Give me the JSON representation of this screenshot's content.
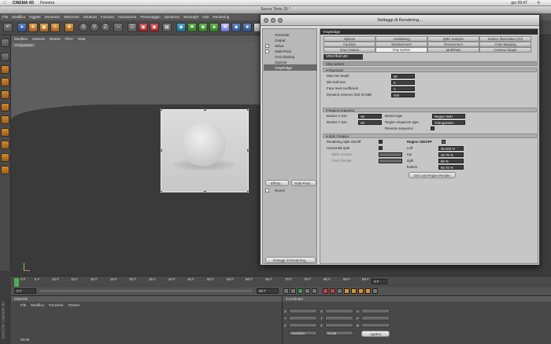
{
  "mac_menubar": {
    "app_name": "CINEMA 4D",
    "menu": "Finestra",
    "clock": "gio 09:47"
  },
  "app": {
    "title": "Senza Titolo 20 *",
    "menu": [
      "File",
      "Modifica",
      "Oggetti",
      "Strumenti",
      "Selezione",
      "Struttura",
      "Funzioni",
      "Animazione",
      "Personaggio",
      "Dynamics",
      "MoGraph",
      "Hair",
      "Rendering"
    ]
  },
  "viewport": {
    "menu": [
      "Modifica",
      "Camera",
      "Mostra",
      "Filtro",
      "Vista"
    ],
    "label": "Prospettiva"
  },
  "dialog": {
    "title": "Settaggi di Rendering...",
    "nav": [
      {
        "label": "Generale",
        "checkbox": false
      },
      {
        "label": "Output",
        "checkbox": false
      },
      {
        "label": "Salva",
        "checkbox": true
      },
      {
        "label": "Multi-Pass",
        "checkbox": true
      },
      {
        "label": "Anti-Aliasing",
        "checkbox": false
      },
      {
        "label": "Opzioni",
        "checkbox": false
      },
      {
        "label": "VrayBridge",
        "checkbox": false,
        "selected": true
      }
    ],
    "effects_button": "Effetto...",
    "multipass_button": "Multi-Pass...",
    "new_item": "Nuovo",
    "footer_button": "Settaggi di Rendering...",
    "panel_header": "VrayBridge",
    "tabs_row1": [
      "Options",
      "Antialiasing",
      "QMC Sampler",
      "Indirect Illumination (GI)"
    ],
    "tabs_row2": [
      "Caustics",
      "Displacement",
      "Environment",
      "Color Mapping"
    ],
    "tabs_row3": [
      "Vray Camera",
      "Vray system",
      "MultiPass",
      "Camera Clipper"
    ],
    "active_tab": "Vray system",
    "logo": "VRAYforC4D",
    "section_title": "Vray system",
    "raycaster": {
      "heading": "Raycaster",
      "fields": [
        {
          "label": "Max tree depth",
          "value": "60"
        },
        {
          "label": "Min leaf size",
          "value": "0"
        },
        {
          "label": "Face level coefficient",
          "value": "1"
        },
        {
          "label": "Dynamic memory limit (in MB)",
          "value": "400"
        }
      ]
    },
    "region_sequence": {
      "heading": "Region sequence",
      "bucket_x_label": "Bucket X size",
      "bucket_x_value": "48",
      "bucket_y_label": "Bucket Y size",
      "bucket_y_value": "48",
      "bucket_type_label": "Bucket type",
      "bucket_type_value": "Region W/H",
      "region_seq_type_label": "Region sequence type",
      "region_seq_type_value": "Triangulation",
      "reverse_label": "Reverse sequence"
    },
    "split_region": {
      "heading": "Split / Region",
      "render_split_label": "Rendering Split On/Off",
      "horizontal_split_label": "Horizontal Split",
      "splits_number_label": "Splits number",
      "pixel_overlap_label": "Pixel Overlap",
      "region_onoff_label": "Region ON/OFF",
      "left_label": "Left",
      "left_value": "36.563 %",
      "top_label": "top",
      "top_value": "26.75 %",
      "right_label": "right",
      "right_value": "65 %",
      "bottom_label": "bottom",
      "bottom_value": "65.75 %",
      "button": "Get Last Region Render"
    }
  },
  "timeline": {
    "ticks": [
      "0 F",
      "5 F",
      "10 F",
      "15 F",
      "20 F",
      "25 F",
      "30 F",
      "35 F",
      "40 F",
      "45 F",
      "50 F",
      "55 F",
      "60 F",
      "65 F",
      "70 F",
      "75 F",
      "80 F",
      "85 F",
      "90 F"
    ],
    "current_frame": "0 F",
    "start": "0 F",
    "end": "90 F",
    "end_field": "90 F"
  },
  "materials": {
    "title": "Materiali",
    "menu": [
      "File",
      "Modifica",
      "Funzione",
      "Texture"
    ]
  },
  "coords": {
    "title": "Coordinate",
    "axes_a": [
      "X",
      "Y",
      "Z"
    ],
    "axes_b": [
      "X",
      "Y",
      "Z"
    ],
    "axes_c": [
      "H",
      "P",
      "B"
    ],
    "mode_left": "Assoluto",
    "mode_mid": "Scala",
    "apply_button": "Applica"
  },
  "side_logo": "MAXON CINEMA 4D",
  "status": "00:00"
}
